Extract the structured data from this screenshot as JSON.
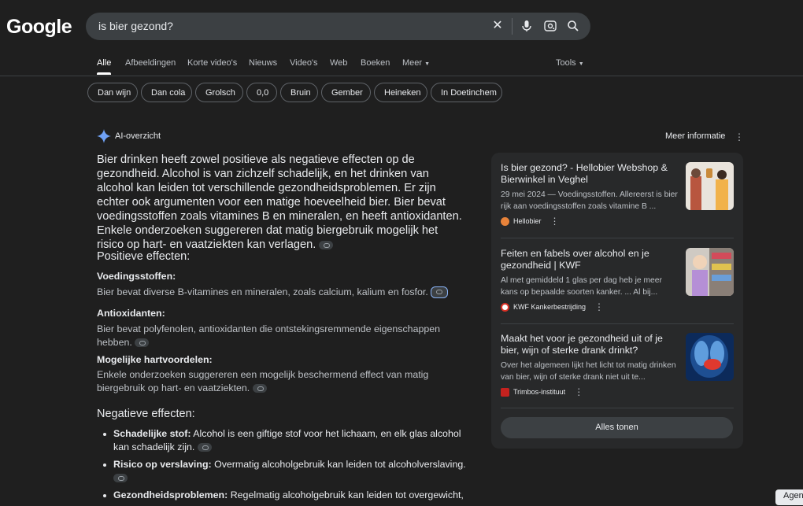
{
  "header": {
    "logo": "Google",
    "search_value": "is bier gezond?",
    "icons": [
      "close-icon",
      "mic-icon",
      "lens-icon",
      "search-icon"
    ]
  },
  "tabs": [
    "Alle",
    "Afbeeldingen",
    "Korte video's",
    "Nieuws",
    "Video's",
    "Web",
    "Boeken",
    "Meer",
    "Tools"
  ],
  "chips": [
    "Dan wijn",
    "Dan cola",
    "Grolsch",
    "0,0",
    "Bruin",
    "Gember",
    "Heineken",
    "In Doetinchem"
  ],
  "ai": {
    "title": "AI-overzicht",
    "more_info": "Meer informatie",
    "intro": "Bier drinken heeft zowel positieve als negatieve effecten op de gezondheid. Alcohol is van zichzelf schadelijk, en het drinken van alcohol kan leiden tot verschillende gezondheidsproblemen. Er zijn echter ook argumenten voor een matige hoeveelheid bier. Bier bevat voedingsstoffen zoals vitamines B en mineralen, en heeft antioxidanten. Enkele onderzoeken suggereren dat matig biergebruik mogelijk het risico op hart- en vaatziekten kan verlagen.",
    "positive_heading": "Positieve effecten:",
    "positives": [
      {
        "title": "Voedingsstoffen:",
        "text": "Bier bevat diverse B-vitamines en mineralen, zoals calcium, kalium en fosfor."
      },
      {
        "title": "Antioxidanten:",
        "text": "Bier bevat polyfenolen, antioxidanten die ontstekingsremmende eigenschappen hebben."
      },
      {
        "title": "Mogelijke hartvoordelen:",
        "text": "Enkele onderzoeken suggereren een mogelijk beschermend effect van matig biergebruik op hart- en vaatziekten."
      }
    ],
    "negative_heading": "Negatieve effecten:",
    "negatives": [
      {
        "title": "Schadelijke stof:",
        "text": " Alcohol is een giftige stof voor het lichaam, en elk glas alcohol kan schadelijk zijn."
      },
      {
        "title": "Risico op verslaving:",
        "text": " Overmatig alcoholgebruik kan leiden tot alcoholverslaving."
      },
      {
        "title": "Gezondheidsproblemen:",
        "text": " Regelmatig alcoholgebruik kan leiden tot overgewicht,"
      }
    ]
  },
  "sources": [
    {
      "title": "Is bier gezond? - Hellobier Webshop & Bierwinkel in Veghel",
      "snippet": "29 mei 2024 — Voedingsstoffen. Allereerst is bier rijk aan voedingsstoffen zoals vitamine B ...",
      "site": "Hellobier",
      "favicon_color": "#e8833a"
    },
    {
      "title": "Feiten en fabels over alcohol en je gezondheid | KWF",
      "snippet": "Al met gemiddeld 1 glas per dag heb je meer kans op bepaalde soorten kanker. ... Al bij...",
      "site": "KWF Kankerbestrijding",
      "favicon_color": "#d93025"
    },
    {
      "title": "Maakt het voor je gezondheid uit of je bier, wijn of sterke drank drinkt?",
      "snippet": "Over het algemeen lijkt het licht tot matig drinken van bier, wijn of sterke drank niet uit te...",
      "site": "Trimbos-instituut",
      "favicon_color": "#c5221f"
    }
  ],
  "show_all": "Alles tonen",
  "agent_button": "Agen"
}
